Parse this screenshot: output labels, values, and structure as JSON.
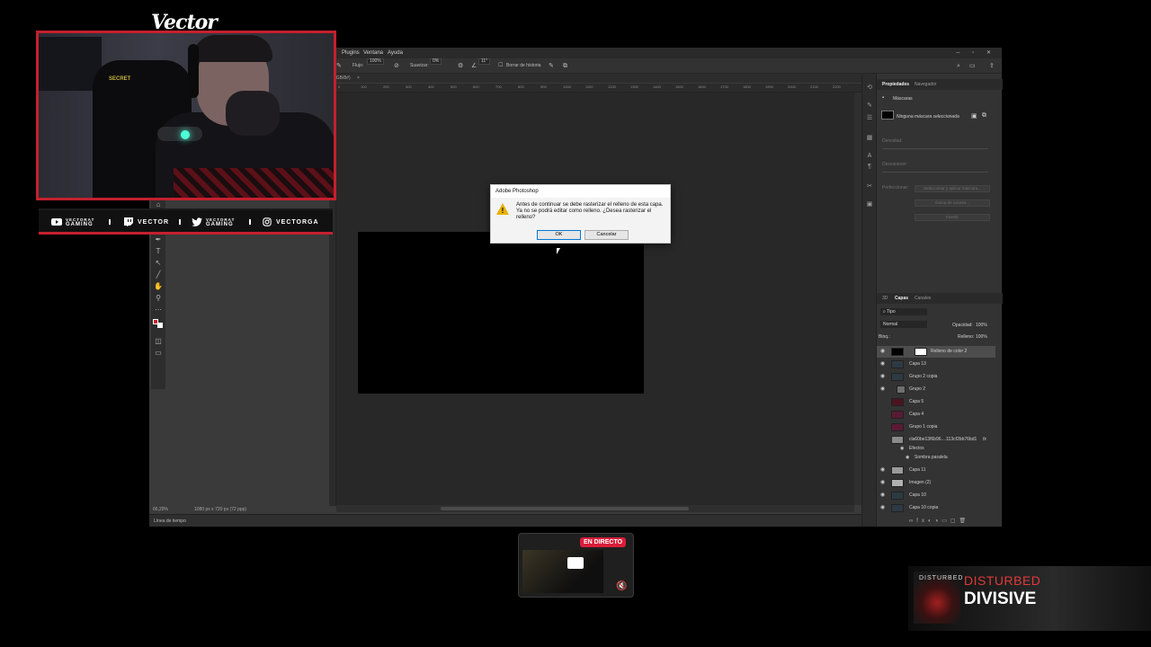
{
  "streamer": {
    "name": "Vector"
  },
  "social": [
    {
      "platform": "youtube",
      "icon": "youtube-icon",
      "line1": "VECTORAT",
      "line2": "GAMING"
    },
    {
      "platform": "twitch",
      "icon": "twitch-icon",
      "text": "VECTOR"
    },
    {
      "platform": "twitter",
      "icon": "twitter-icon",
      "line1": "VECTORAT",
      "line2": "GAMING"
    },
    {
      "platform": "instagram",
      "icon": "instagram-icon",
      "text": "VECTORGA"
    }
  ],
  "webcam": {
    "chair_brand": "SECRET"
  },
  "photoshop": {
    "menu": [
      "Plugins",
      "Ventana",
      "Ayuda"
    ],
    "options": {
      "flow_label": "Flujo:",
      "flow_value": "100%",
      "smooth_label": "Suavizar:",
      "smooth_value": "0%",
      "angle_value": "11°",
      "erase_history": "Borrar de historia"
    },
    "doc_tab": "/, RGB/8#)",
    "ruler_ticks": [
      "0",
      "100",
      "200",
      "300",
      "400",
      "500",
      "600",
      "700",
      "800",
      "900",
      "1000",
      "1100",
      "1200",
      "1300",
      "1400",
      "1500",
      "1600",
      "1700",
      "1800",
      "1900",
      "2000",
      "2100",
      "2200"
    ],
    "status_zoom": "66,29%",
    "status_size": "1080 px x 720 px (72 ppp)",
    "timeline_label": "Línea de tiempo",
    "properties": {
      "tabs": [
        "Propiedades",
        "Navegador"
      ],
      "masks_label": "Máscaras",
      "mask_status": "Ninguna máscara seleccionada",
      "density_label": "Densidad:",
      "feather_label": "Desvanecer:",
      "refine_label": "Perfeccionar:",
      "btn_select_mask": "Seleccionar y aplicar máscara...",
      "btn_color_range": "Gama de colores...",
      "btn_invert": "Invertir"
    },
    "layers": {
      "tabs": [
        "3D",
        "Capas",
        "Canales"
      ],
      "filter_kind": "Tipo",
      "blend_mode": "Normal",
      "opacity_label": "Opacidad:",
      "opacity_value": "100%",
      "lock_label": "Bloq.:",
      "fill_label": "Relleno:",
      "fill_value": "100%",
      "items": [
        {
          "name": "Relleno de color 2",
          "selected": true
        },
        {
          "name": "Capa 13"
        },
        {
          "name": "Grupo 2 copia"
        },
        {
          "name": "Grupo 2"
        },
        {
          "name": "Capa 5"
        },
        {
          "name": "Capa 4"
        },
        {
          "name": "Grupo 1 copia"
        },
        {
          "name": "cla60be13f6b96....113cf2bb76bd1"
        },
        {
          "name": "Efectos"
        },
        {
          "name": "Sombra paralela"
        },
        {
          "name": "Capa 11"
        },
        {
          "name": "Imagen (2)"
        },
        {
          "name": "Capa 10"
        },
        {
          "name": "Capa 10 copia"
        }
      ]
    }
  },
  "dialog": {
    "title": "Adobe Photoshop",
    "message": "Antes de continuar se debe rasterizar el relleno de esta capa. Ya no se podrá editar como relleno. ¿Desea rasterizar el relleno?",
    "ok_label": "OK",
    "cancel_label": "Cancelar"
  },
  "scene": {
    "live_label": "EN DIRECTO"
  },
  "now_playing": {
    "album_art_text": "DISTURBED",
    "band": "DISTURBED",
    "album": "DIVISIVE"
  }
}
